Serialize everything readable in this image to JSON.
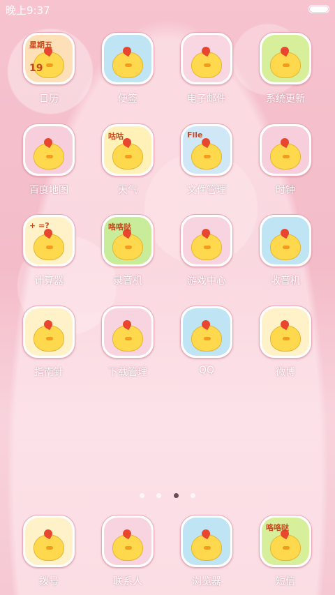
{
  "status_bar": {
    "time": "晚上9:37"
  },
  "apps": [
    {
      "label": "日历",
      "icon": "calendar-icon",
      "tile_text": "星期五",
      "date_text": "19",
      "bg": "#fde0b8"
    },
    {
      "label": "便签",
      "icon": "notes-icon",
      "bg": "#bfe4f4"
    },
    {
      "label": "电子邮件",
      "icon": "email-icon",
      "bg": "#f8d6e2"
    },
    {
      "label": "系统更新",
      "icon": "system-update-icon",
      "bg": "#d7ef9a"
    },
    {
      "label": "百度地图",
      "icon": "baidu-map-icon",
      "bg": "#f7cfdc"
    },
    {
      "label": "天气",
      "icon": "weather-icon",
      "tile_text": "咕咕",
      "bg": "#fff1b8"
    },
    {
      "label": "文件管理",
      "icon": "file-manager-icon",
      "tile_text": "File",
      "bg": "#cfe7f7"
    },
    {
      "label": "时钟",
      "icon": "clock-icon",
      "bg": "#f7cfdc"
    },
    {
      "label": "计算器",
      "icon": "calculator-icon",
      "tile_text": "+ =?",
      "bg": "#fff1c8"
    },
    {
      "label": "录音机",
      "icon": "recorder-icon",
      "tile_text": "咯咯哒",
      "bg": "#c9ec9a"
    },
    {
      "label": "游戏中心",
      "icon": "game-center-icon",
      "bg": "#f8d4e0"
    },
    {
      "label": "收音机",
      "icon": "radio-icon",
      "bg": "#bfe4f4"
    },
    {
      "label": "指南针",
      "icon": "compass-icon",
      "bg": "#fff1c8"
    },
    {
      "label": "下载管理",
      "icon": "download-manager-icon",
      "bg": "#f8d4e0"
    },
    {
      "label": "QQ",
      "icon": "qq-icon",
      "bg": "#bfe4f4"
    },
    {
      "label": "微博",
      "icon": "weibo-icon",
      "bg": "#fff1c8"
    }
  ],
  "page_indicator": {
    "count": 4,
    "active": 2
  },
  "dock": [
    {
      "label": "拨号",
      "icon": "dialer-icon",
      "bg": "#fff1c8"
    },
    {
      "label": "联系人",
      "icon": "contacts-icon",
      "bg": "#f8d4e0"
    },
    {
      "label": "浏览器",
      "icon": "browser-icon",
      "bg": "#bfe4f4"
    },
    {
      "label": "短信",
      "icon": "sms-icon",
      "tile_text": "咯咯哒",
      "bg": "#d7ef9a"
    }
  ]
}
